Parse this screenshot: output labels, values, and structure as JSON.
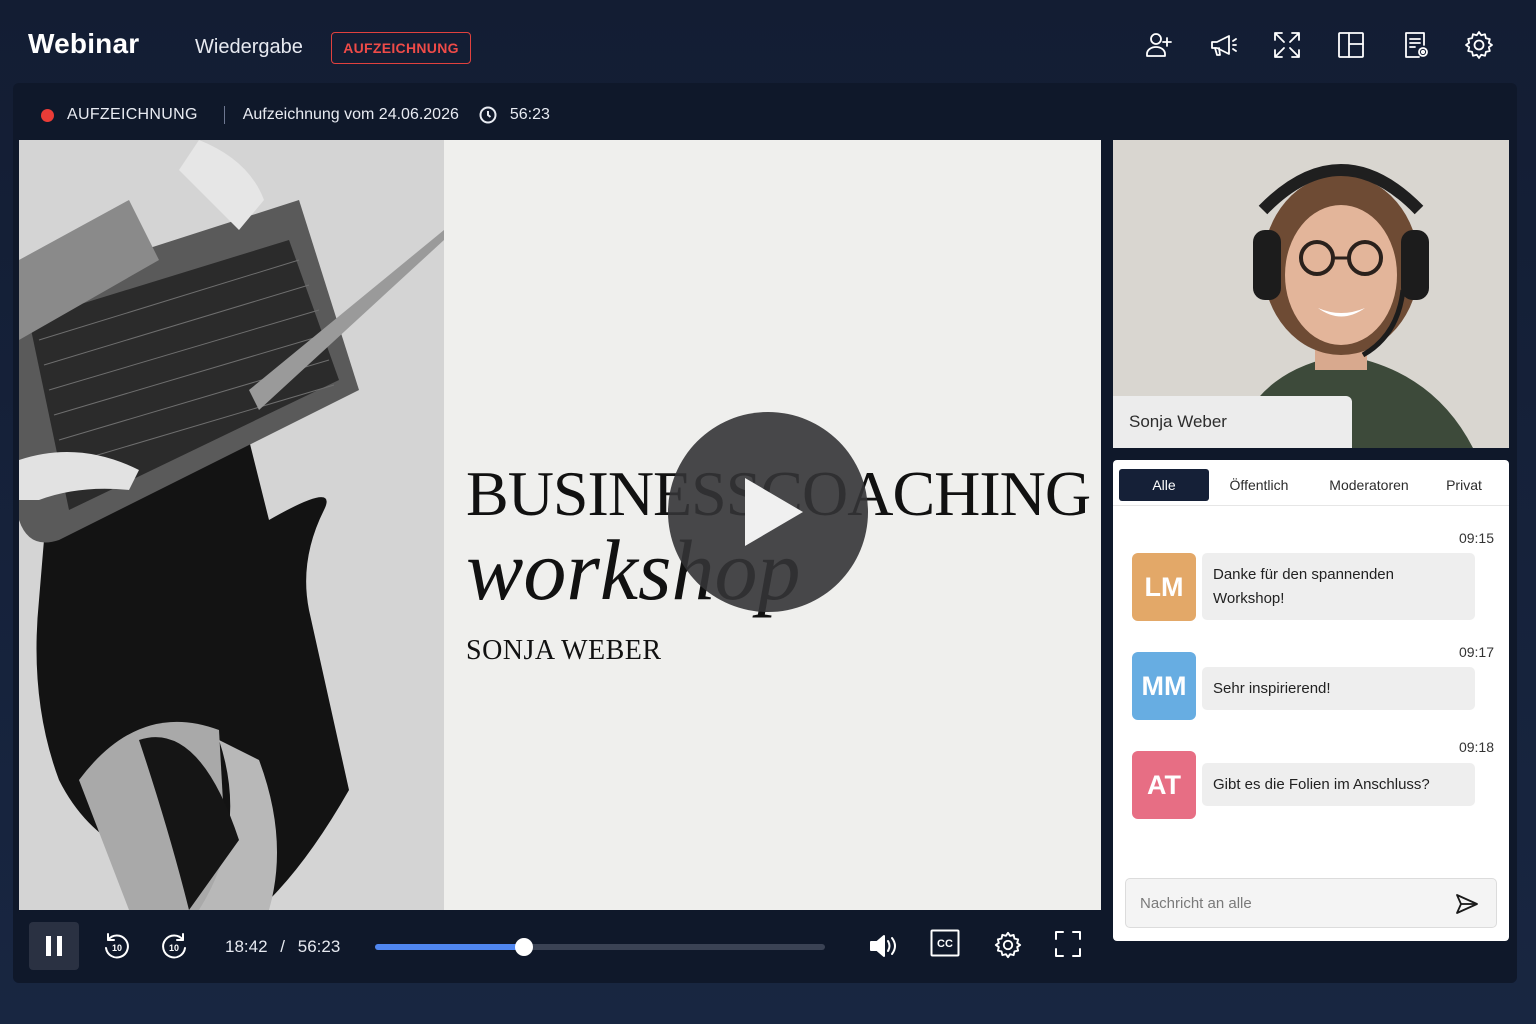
{
  "header": {
    "brand": "Webinar",
    "nav_label": "Wiedergabe",
    "rec_badge": "AUFZEICHNUNG",
    "icons": [
      "add-user-icon",
      "megaphone-icon",
      "expand-icon",
      "layout-icon",
      "document-settings-icon",
      "gear-icon"
    ]
  },
  "status": {
    "label": "AUFZEICHNUNG",
    "date_text": "Aufzeichnung vom 24.06.2026",
    "duration": "56:23",
    "dot_color": "#ea3c37"
  },
  "slide": {
    "title": "BUSINESSCOACHING",
    "subtitle": "workshop",
    "presenter": "SONJA WEBER"
  },
  "player": {
    "current_time": "18:42",
    "separator": "/",
    "total_time": "56:23",
    "progress_fraction": 0.332,
    "accent": "#4f86f0"
  },
  "camera": {
    "name": "Sonja Weber"
  },
  "chat": {
    "tabs": [
      {
        "label": "Alle",
        "active": true
      },
      {
        "label": "Öffentlich",
        "active": false
      },
      {
        "label": "Moderatoren",
        "active": false
      },
      {
        "label": "Privat",
        "active": false
      }
    ],
    "messages": [
      {
        "initials": "LM",
        "color": "#e3a868",
        "time": "09:15",
        "text": "Danke für den spannenden Workshop!"
      },
      {
        "initials": "MM",
        "color": "#67ade2",
        "time": "09:17",
        "text": "Sehr inspirierend!"
      },
      {
        "initials": "AT",
        "color": "#e76e84",
        "time": "09:18",
        "text": "Gibt es die Folien im Anschluss?"
      }
    ],
    "input_placeholder": "Nachricht an alle"
  }
}
